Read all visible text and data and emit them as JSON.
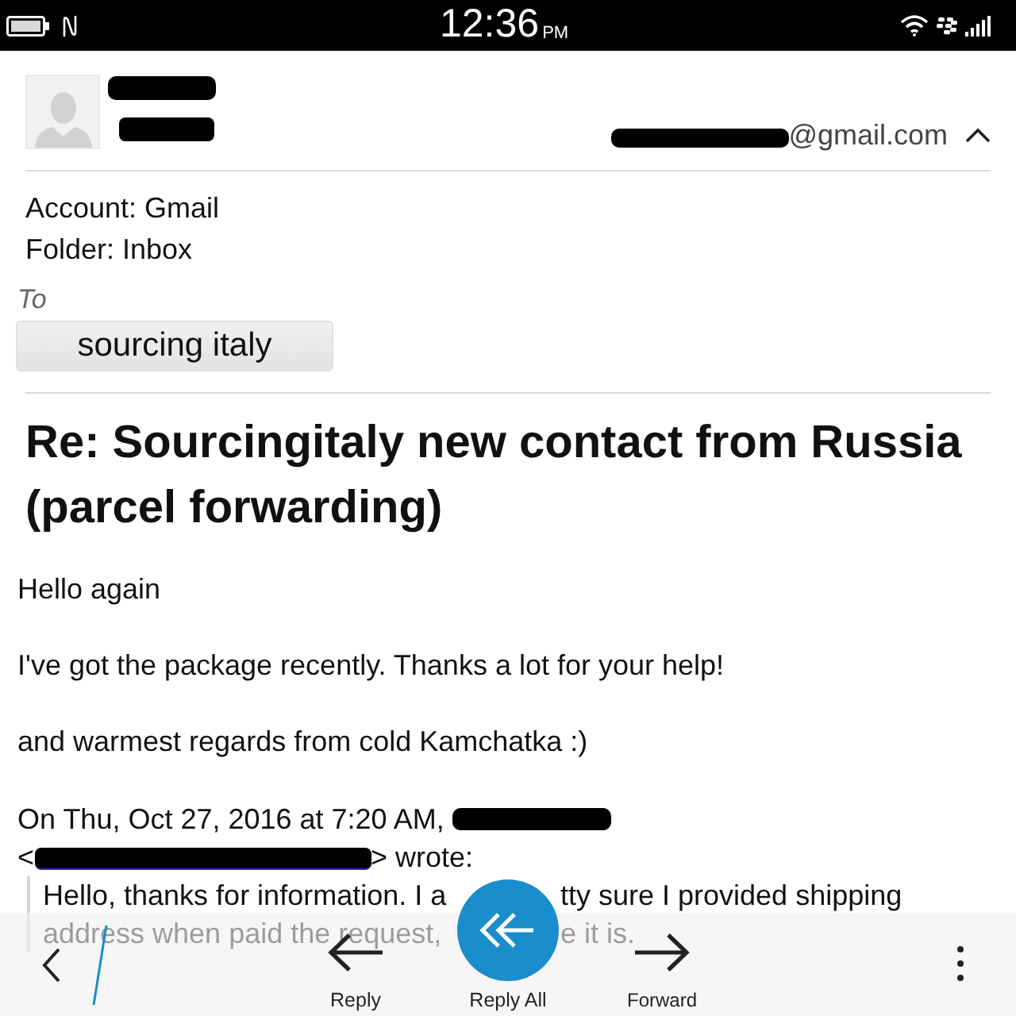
{
  "status_bar": {
    "time": "12:36",
    "meridiem": "PM"
  },
  "sender": {
    "name_redacted": true,
    "email_prefix_redacted": true,
    "email_visible": "@gmail.com",
    "expanded": true
  },
  "details": {
    "account": "Account: Gmail",
    "folder": "Folder: Inbox",
    "to_label": "To",
    "recipients": [
      "sourcing italy"
    ]
  },
  "subject": "Re: Sourcingitaly new contact from Russia (parcel forwarding)",
  "body": {
    "paragraphs": [
      "Hello again",
      "I've got the package recently. Thanks a lot for your help!",
      "and warmest regards from cold Kamchatka :)"
    ],
    "attribution": {
      "line_1": "On Thu, Oct 27, 2016 at 7:20 AM,",
      "name_redacted": true,
      "open": "<",
      "link_redacted": true,
      "close": "> wrote:"
    },
    "quote_lines": [
      [
        "Hello, thanks for information. I a",
        "tty sure I provided shipping"
      ],
      [
        "address when paid the request,",
        "e it is."
      ]
    ]
  },
  "toolbar": [
    {
      "kind": "back"
    },
    {
      "kind": "reply",
      "label": "Reply"
    },
    {
      "kind": "reply_all",
      "label": "Reply All"
    },
    {
      "kind": "forward",
      "label": "Forward"
    },
    {
      "kind": "overflow"
    }
  ]
}
